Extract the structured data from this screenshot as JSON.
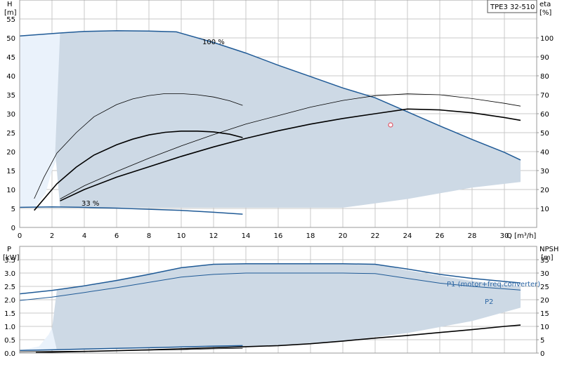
{
  "model_label": "TPE3 32-510",
  "colors": {
    "grid": "#c8c8c8",
    "area_fill": "#cdd9e5",
    "area_light": "#eaf2fb",
    "blue": "#1f5a96",
    "label_blue": "#2d67a5",
    "black": "#000000",
    "marker": "#e05a6a"
  },
  "chart_data": [
    {
      "type": "line",
      "name": "upper",
      "xlabel": "Q [m³/h]",
      "ylabel_left": "H\n[m]",
      "ylabel_right": "eta\n[%]",
      "xlim": [
        0,
        32
      ],
      "ylim_left": [
        0,
        60
      ],
      "ylim_right": [
        0,
        120
      ],
      "x_ticks": [
        0,
        2,
        4,
        6,
        8,
        10,
        12,
        14,
        16,
        18,
        20,
        22,
        24,
        26,
        28,
        30
      ],
      "y_ticks_left": [
        0,
        5,
        10,
        15,
        20,
        25,
        30,
        35,
        40,
        45,
        50,
        55
      ],
      "y_ticks_right": [
        10,
        20,
        30,
        40,
        50,
        60,
        70,
        80,
        90,
        100
      ],
      "annotations": [
        {
          "text": "100 %",
          "x": 12.0,
          "y": 53.0
        },
        {
          "text": "33 %",
          "x": 4.0,
          "y": 6.2
        }
      ],
      "operating_point": {
        "x": 24.5,
        "y": 29.3
      },
      "series": [
        {
          "axis": "left",
          "style": "area_light",
          "points": [
            [
              0,
              0
            ],
            [
              0,
              50.5
            ],
            [
              2.5,
              51.3
            ],
            [
              2.5,
              20
            ],
            [
              2,
              15
            ],
            [
              1.6,
              9
            ],
            [
              1,
              5.5
            ],
            [
              0,
              5.5
            ]
          ]
        },
        {
          "axis": "left",
          "style": "area_fill",
          "points": [
            [
              2.5,
              51.3
            ],
            [
              4,
              51.7
            ],
            [
              6,
              51.9
            ],
            [
              8,
              51.8
            ],
            [
              9.7,
              51.6
            ],
            [
              12,
              48.8
            ],
            [
              14,
              46
            ],
            [
              16,
              42.8
            ],
            [
              18,
              39.8
            ],
            [
              20,
              36.8
            ],
            [
              22,
              34.2
            ],
            [
              24,
              30.5
            ],
            [
              26,
              26.8
            ],
            [
              28,
              23.2
            ],
            [
              30,
              19.8
            ],
            [
              31,
              17.8
            ],
            [
              31,
              12
            ],
            [
              28,
              10.5
            ],
            [
              24,
              7.5
            ],
            [
              20,
              5.2
            ],
            [
              14,
              5.2
            ],
            [
              4,
              5.2
            ],
            [
              2.5,
              5.3
            ],
            [
              2.2,
              20
            ],
            [
              2.5,
              51.3
            ]
          ]
        },
        {
          "axis": "left",
          "style": "blue",
          "points": [
            [
              0,
              50.5
            ],
            [
              2.5,
              51.3
            ],
            [
              4,
              51.7
            ],
            [
              6,
              51.9
            ],
            [
              8,
              51.8
            ],
            [
              9.7,
              51.6
            ],
            [
              12,
              48.8
            ],
            [
              14,
              46
            ],
            [
              16,
              42.8
            ],
            [
              18,
              39.8
            ],
            [
              20,
              36.8
            ],
            [
              22,
              34.2
            ],
            [
              24,
              30.5
            ],
            [
              26,
              26.8
            ],
            [
              28,
              23.2
            ],
            [
              30,
              19.8
            ],
            [
              31,
              17.8
            ]
          ]
        },
        {
          "axis": "left",
          "style": "blue",
          "points": [
            [
              0,
              5.3
            ],
            [
              2,
              5.4
            ],
            [
              4,
              5.3
            ],
            [
              6,
              5.1
            ],
            [
              8,
              4.8
            ],
            [
              10,
              4.5
            ],
            [
              12,
              4.0
            ],
            [
              13.8,
              3.5
            ]
          ]
        },
        {
          "axis": "left",
          "style": "black_thin",
          "points": [
            [
              0.9,
              7.6
            ],
            [
              1.5,
              13.2
            ],
            [
              2.3,
              19.6
            ],
            [
              3.5,
              25
            ],
            [
              4.6,
              29.2
            ],
            [
              6,
              32.4
            ],
            [
              7,
              33.9
            ],
            [
              8,
              34.8
            ],
            [
              9,
              35.3
            ],
            [
              10,
              35.3
            ],
            [
              11,
              35.0
            ],
            [
              12,
              34.4
            ],
            [
              13,
              33.4
            ],
            [
              13.8,
              32.2
            ]
          ]
        },
        {
          "axis": "left",
          "style": "black_thick",
          "points": [
            [
              0.9,
              4.5
            ],
            [
              2.3,
              11.5
            ],
            [
              3.5,
              15.9
            ],
            [
              4.6,
              19.1
            ],
            [
              6,
              21.8
            ],
            [
              7,
              23.3
            ],
            [
              8,
              24.4
            ],
            [
              9,
              25.1
            ],
            [
              10,
              25.4
            ],
            [
              11,
              25.4
            ],
            [
              12,
              25.2
            ],
            [
              13,
              24.6
            ],
            [
              13.8,
              23.7
            ]
          ]
        },
        {
          "axis": "right",
          "style": "black_thin",
          "points": [
            [
              2.5,
              15
            ],
            [
              4,
              22
            ],
            [
              6,
              29.5
            ],
            [
              8,
              36.5
            ],
            [
              10,
              43
            ],
            [
              12,
              49
            ],
            [
              14,
              54.5
            ],
            [
              16,
              59
            ],
            [
              18,
              63.5
            ],
            [
              20,
              67
            ],
            [
              22,
              69.5
            ],
            [
              24,
              70.5
            ],
            [
              26,
              70
            ],
            [
              28,
              68
            ],
            [
              30,
              65.5
            ],
            [
              31,
              64
            ]
          ]
        },
        {
          "axis": "right",
          "style": "black_thick",
          "points": [
            [
              2.5,
              14
            ],
            [
              4,
              20
            ],
            [
              6,
              26.5
            ],
            [
              8,
              32
            ],
            [
              10,
              37.5
            ],
            [
              12,
              42.5
            ],
            [
              14,
              47
            ],
            [
              16,
              51
            ],
            [
              18,
              54.5
            ],
            [
              20,
              57.5
            ],
            [
              22,
              60
            ],
            [
              24,
              62.5
            ],
            [
              26,
              62
            ],
            [
              28,
              60.5
            ],
            [
              30,
              58
            ],
            [
              31,
              56.5
            ]
          ]
        }
      ]
    },
    {
      "type": "line",
      "name": "lower",
      "ylabel_left": "P\n[kW]",
      "ylabel_right": "NPSH\n[m]",
      "xlim": [
        0,
        32
      ],
      "ylim_left": [
        0,
        4.0
      ],
      "ylim_right": [
        0,
        40
      ],
      "y_ticks_left": [
        "0.0",
        "0.5",
        "1.0",
        "1.5",
        "2.0",
        "2.5",
        "3.0",
        "3.5"
      ],
      "y_ticks_right": [
        0,
        5,
        10,
        15,
        20,
        25,
        30,
        35
      ],
      "series_labels": [
        {
          "text": "P1 (motor+freq.converter)",
          "x": 28.5,
          "y": 2.85
        },
        {
          "text": "P2",
          "x": 30.6,
          "y": 2.13
        }
      ],
      "series": [
        {
          "axis": "left",
          "style": "area_light",
          "points": [
            [
              0,
              0
            ],
            [
              0,
              0.1
            ],
            [
              2.3,
              0.12
            ],
            [
              2.3,
              1.3
            ],
            [
              1.8,
              0.7
            ],
            [
              1.2,
              0.25
            ],
            [
              0,
              0.1
            ]
          ]
        },
        {
          "axis": "left",
          "style": "area_fill",
          "points": [
            [
              2.3,
              2.36
            ],
            [
              4,
              2.52
            ],
            [
              6,
              2.75
            ],
            [
              8,
              2.98
            ],
            [
              10,
              3.22
            ],
            [
              12,
              3.33
            ],
            [
              14,
              3.35
            ],
            [
              16,
              3.35
            ],
            [
              18,
              3.35
            ],
            [
              20,
              3.35
            ],
            [
              22,
              3.35
            ],
            [
              24,
              3.1
            ],
            [
              26,
              2.9
            ],
            [
              28,
              2.7
            ],
            [
              31,
              2.5
            ],
            [
              31,
              1.7
            ],
            [
              28,
              1.2
            ],
            [
              24,
              0.75
            ],
            [
              20,
              0.45
            ],
            [
              16,
              0.3
            ],
            [
              13.8,
              0.25
            ],
            [
              4,
              0.15
            ],
            [
              2.3,
              0.12
            ],
            [
              2.0,
              0.9
            ],
            [
              2.3,
              2.36
            ]
          ]
        },
        {
          "axis": "left",
          "style": "blue",
          "points": [
            [
              0,
              2.22
            ],
            [
              2,
              2.35
            ],
            [
              4,
              2.52
            ],
            [
              6,
              2.72
            ],
            [
              8,
              2.95
            ],
            [
              10,
              3.2
            ],
            [
              12,
              3.33
            ],
            [
              14,
              3.35
            ],
            [
              16,
              3.35
            ],
            [
              18,
              3.35
            ],
            [
              20,
              3.35
            ],
            [
              22,
              3.33
            ],
            [
              24,
              3.15
            ],
            [
              26,
              2.95
            ],
            [
              28,
              2.8
            ],
            [
              31,
              2.63
            ]
          ]
        },
        {
          "axis": "left",
          "style": "blue_thin",
          "points": [
            [
              0,
              1.97
            ],
            [
              2,
              2.1
            ],
            [
              4,
              2.27
            ],
            [
              6,
              2.45
            ],
            [
              8,
              2.65
            ],
            [
              10,
              2.85
            ],
            [
              12,
              2.95
            ],
            [
              14,
              3.0
            ],
            [
              16,
              3.0
            ],
            [
              18,
              3.0
            ],
            [
              20,
              3.0
            ],
            [
              22,
              2.98
            ],
            [
              24,
              2.8
            ],
            [
              26,
              2.62
            ],
            [
              28,
              2.5
            ],
            [
              31,
              2.36
            ]
          ]
        },
        {
          "axis": "left",
          "style": "blue",
          "points": [
            [
              0,
              0.1
            ],
            [
              2,
              0.12
            ],
            [
              4,
              0.15
            ],
            [
              6,
              0.18
            ],
            [
              8,
              0.2
            ],
            [
              10,
              0.23
            ],
            [
              12,
              0.26
            ],
            [
              13.8,
              0.28
            ]
          ]
        },
        {
          "axis": "left",
          "style": "black_thin",
          "points": [
            [
              0,
              0.05
            ],
            [
              2,
              0.06
            ],
            [
              4,
              0.07
            ],
            [
              6,
              0.09
            ],
            [
              8,
              0.11
            ],
            [
              10,
              0.13
            ],
            [
              12,
              0.16
            ],
            [
              13.8,
              0.18
            ]
          ]
        },
        {
          "axis": "right",
          "style": "black_thick",
          "points": [
            [
              1.0,
              0.2
            ],
            [
              4,
              0.6
            ],
            [
              8,
              1.2
            ],
            [
              12,
              2.0
            ],
            [
              14,
              2.4
            ],
            [
              16,
              2.8
            ],
            [
              18,
              3.5
            ],
            [
              20,
              4.5
            ],
            [
              22,
              5.6
            ],
            [
              24,
              6.6
            ],
            [
              26,
              7.7
            ],
            [
              28,
              8.8
            ],
            [
              30,
              10.0
            ],
            [
              31,
              10.5
            ]
          ]
        }
      ]
    }
  ]
}
